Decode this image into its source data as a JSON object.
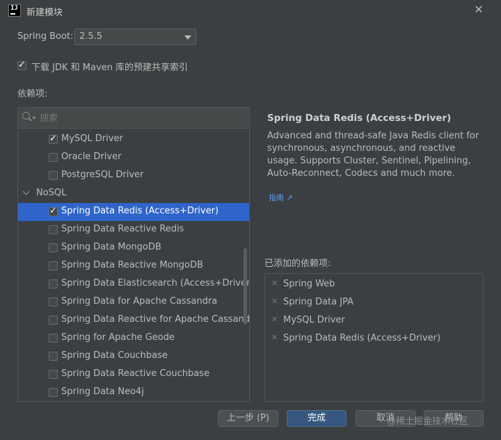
{
  "window": {
    "title": "新建模块",
    "app_icon_text": "IJ"
  },
  "spring_boot": {
    "label": "Spring Boot:",
    "version": "2.5.5"
  },
  "download_option": {
    "label": "下载 JDK 和 Maven 库的预建共享索引",
    "checked": true
  },
  "dependencies_label": "依赖项:",
  "search": {
    "placeholder": "搜索"
  },
  "dependency_list": [
    {
      "label": "MySQL Driver",
      "checked": true
    },
    {
      "label": "Oracle Driver",
      "checked": false
    },
    {
      "label": "PostgreSQL Driver",
      "checked": false
    },
    {
      "label": "NoSQL",
      "group": true
    },
    {
      "label": "Spring Data Redis (Access+Driver)",
      "checked": true,
      "selected": true
    },
    {
      "label": "Spring Data Reactive Redis",
      "checked": false
    },
    {
      "label": "Spring Data MongoDB",
      "checked": false
    },
    {
      "label": "Spring Data Reactive MongoDB",
      "checked": false
    },
    {
      "label": "Spring Data Elasticsearch (Access+Driver)",
      "checked": false
    },
    {
      "label": "Spring Data for Apache Cassandra",
      "checked": false
    },
    {
      "label": "Spring Data Reactive for Apache Cassandr",
      "checked": false
    },
    {
      "label": "Spring for Apache Geode",
      "checked": false
    },
    {
      "label": "Spring Data Couchbase",
      "checked": false
    },
    {
      "label": "Spring Data Reactive Couchbase",
      "checked": false
    },
    {
      "label": "Spring Data Neo4j",
      "checked": false
    }
  ],
  "detail": {
    "title": "Spring Data Redis (Access+Driver)",
    "description": "Advanced and thread-safe Java Redis client for synchronous, asynchronous, and reactive usage. Supports Cluster, Sentinel, Pipelining, Auto-Reconnect, Codecs and much more.",
    "guide_link": "指南 ↗"
  },
  "added": {
    "label": "已添加的依赖项:",
    "items": [
      "Spring Web",
      "Spring Data JPA",
      "MySQL Driver",
      "Spring Data Redis (Access+Driver)"
    ]
  },
  "buttons": {
    "previous": "上一步 (P)",
    "finish": "完成",
    "cancel": "取消",
    "help": "帮助"
  },
  "watermark": "@稀土掘金技术社区",
  "colors": {
    "background": "#3c3f41",
    "selection": "#2f65ca",
    "primary_button": "#365880",
    "link": "#589df6"
  }
}
